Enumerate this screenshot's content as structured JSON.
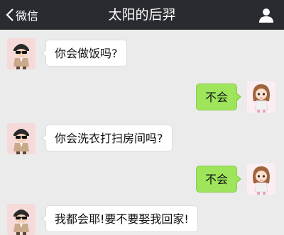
{
  "colors": {
    "header_bg": "#2a2b30",
    "chat_bg": "#ebebeb",
    "sent_bubble": "#9fe55c",
    "received_bubble": "#ffffff"
  },
  "header": {
    "back_label": "微信",
    "title": "太阳的后羿",
    "back_icon": "chevron-left-icon",
    "profile_icon": "person-icon"
  },
  "messages": [
    {
      "from": "contact",
      "text": "你会做饭吗?"
    },
    {
      "from": "me",
      "text": "不会"
    },
    {
      "from": "contact",
      "text": "你会洗衣打扫房间吗?"
    },
    {
      "from": "me",
      "text": "不会"
    },
    {
      "from": "contact",
      "text": "我都会耶!要不要娶我回家!"
    }
  ]
}
